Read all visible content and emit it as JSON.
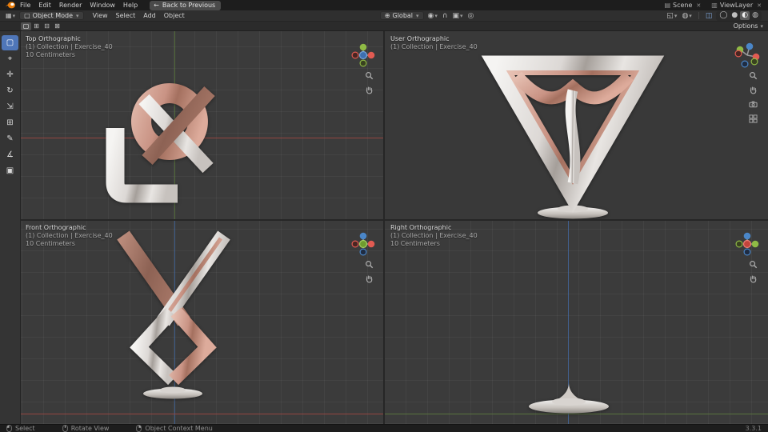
{
  "app": {
    "name": "Blender"
  },
  "colors": {
    "accent_blue": "#4772b3",
    "viewport_bg": "#3b3b3b",
    "topbar_bg": "#1d1d1d",
    "axis_x_red": "#9e4742",
    "axis_y_green": "#5d7a3e",
    "axis_z_blue": "#44679c",
    "metal_silver": "#dcd8d5",
    "metal_copper": "#c99384"
  },
  "topbar": {
    "menus": [
      {
        "label": "File"
      },
      {
        "label": "Edit"
      },
      {
        "label": "Render"
      },
      {
        "label": "Window"
      },
      {
        "label": "Help"
      }
    ],
    "back_button_label": "Back to Previous",
    "scene_selector": {
      "label": "Scene"
    },
    "view_layer_selector": {
      "label": "ViewLayer"
    }
  },
  "viewport_header": {
    "mode_selector_label": "Object Mode",
    "menus": [
      {
        "label": "View"
      },
      {
        "label": "Select"
      },
      {
        "label": "Add"
      },
      {
        "label": "Object"
      }
    ],
    "transform_orientation_label": "Global",
    "options_button_label": "Options"
  },
  "tool_sidebar": {
    "tools": [
      {
        "name": "select-box",
        "glyph": "▢",
        "active": true
      },
      {
        "name": "cursor",
        "glyph": "⌖",
        "active": false
      },
      {
        "name": "move",
        "glyph": "✛",
        "active": false
      },
      {
        "name": "rotate",
        "glyph": "↻",
        "active": false
      },
      {
        "name": "scale",
        "glyph": "⇲",
        "active": false
      },
      {
        "name": "transform",
        "glyph": "⊞",
        "active": false
      },
      {
        "name": "annotate",
        "glyph": "✎",
        "active": false
      },
      {
        "name": "measure",
        "glyph": "∡",
        "active": false
      },
      {
        "name": "add-cube",
        "glyph": "▣",
        "active": false
      }
    ]
  },
  "tool_settings": {
    "icons": [
      {
        "glyph": "▢"
      },
      {
        "glyph": "⊞"
      },
      {
        "glyph": "⊟"
      },
      {
        "glyph": "⊠"
      }
    ]
  },
  "quad_view": {
    "viewports": [
      {
        "title": "Top Orthographic",
        "breadcrumb": "(1) Collection | Exercise_40",
        "grid_scale": "10 Centimeters"
      },
      {
        "title": "User Orthographic",
        "breadcrumb": "(1) Collection | Exercise_40",
        "grid_scale": ""
      },
      {
        "title": "Front Orthographic",
        "breadcrumb": "(1) Collection | Exercise_40",
        "grid_scale": "10 Centimeters"
      },
      {
        "title": "Right Orthographic",
        "breadcrumb": "(1) Collection | Exercise_40",
        "grid_scale": "10 Centimeters"
      }
    ]
  },
  "status_bar": {
    "hints": [
      {
        "label": "Select"
      },
      {
        "label": "Rotate View"
      },
      {
        "label": "Object Context Menu"
      }
    ],
    "version": "3.3.1"
  },
  "icons": {
    "dropdown": "▾",
    "close": "✕",
    "back_arrow": "←",
    "editor_type": "▦",
    "mode": "▢",
    "globe": "⊕",
    "pivot": "◉",
    "magnet": "∩",
    "snap": "▣",
    "proportional": "◎",
    "gizmo": "◱",
    "overlays": "◍",
    "xray": "◫",
    "shading_wireframe": "◯",
    "shading_solid": "●",
    "shading_material": "◐",
    "shading_rendered": "◍",
    "scene": "▤",
    "view_layer": "▥"
  }
}
